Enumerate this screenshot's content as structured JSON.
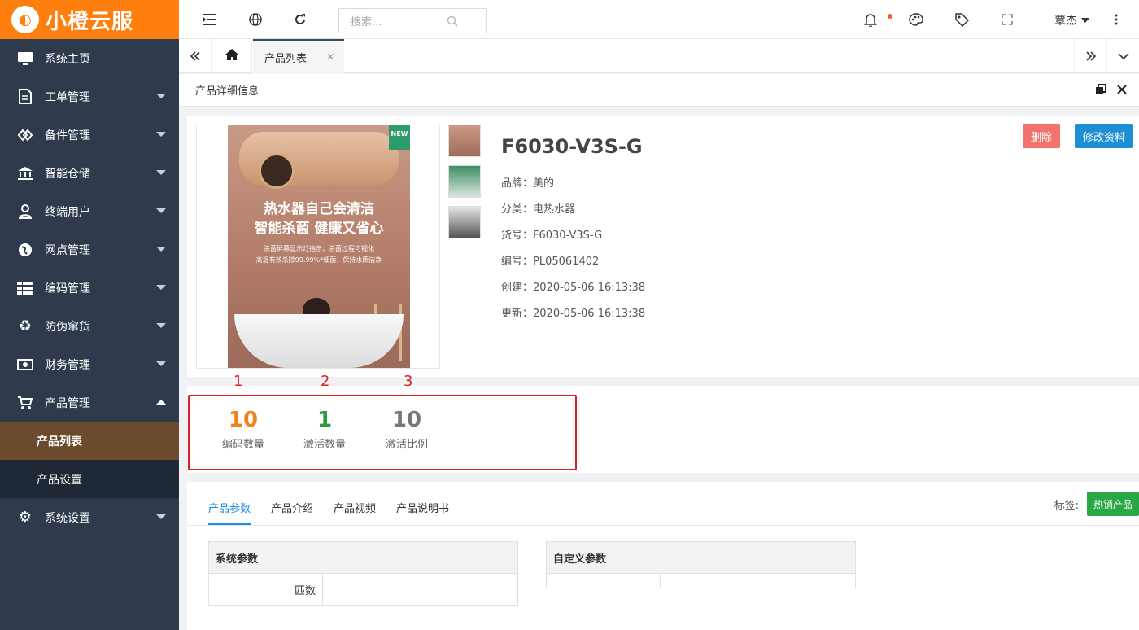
{
  "app": {
    "logo_text": "小橙云服"
  },
  "sidebar": {
    "items": [
      {
        "label": "系统主页",
        "icon": "monitor-icon"
      },
      {
        "label": "工单管理",
        "icon": "document-icon"
      },
      {
        "label": "备件管理",
        "icon": "parts-icon"
      },
      {
        "label": "智能仓储",
        "icon": "bank-icon"
      },
      {
        "label": "终端用户",
        "icon": "user-icon"
      },
      {
        "label": "网点管理",
        "icon": "globe-icon"
      },
      {
        "label": "编码管理",
        "icon": "grid-icon"
      },
      {
        "label": "防伪窜货",
        "icon": "recycle-icon"
      },
      {
        "label": "财务管理",
        "icon": "money-icon"
      },
      {
        "label": "产品管理",
        "icon": "cart-icon"
      },
      {
        "label": "系统设置",
        "icon": "gear-icon"
      }
    ],
    "product_sub": [
      "产品列表",
      "产品设置"
    ]
  },
  "header": {
    "search_placeholder": "搜索...",
    "user": "覃杰"
  },
  "tabs": {
    "current": "产品列表"
  },
  "panel": {
    "title": "产品详细信息"
  },
  "product": {
    "name": "F6030-V3S-G",
    "fields": [
      {
        "label": "品牌：",
        "value": "美的"
      },
      {
        "label": "分类：",
        "value": "电热水器"
      },
      {
        "label": "货号：",
        "value": "F6030-V3S-G"
      },
      {
        "label": "编号：",
        "value": "PL05061402"
      },
      {
        "label": "创建：",
        "value": "2020-05-06 16:13:38"
      },
      {
        "label": "更新：",
        "value": "2020-05-06 16:13:38"
      }
    ],
    "delete_label": "删除",
    "edit_label": "修改资料",
    "poster": {
      "badge": "NEW",
      "headline1": "热水器自己会清洁",
      "headline2": "智能杀菌 健康又省心",
      "sub1": "杀菌屏幕显示灯指示，杀菌过程可视化",
      "sub2": "高温有效杀除99.99%*细菌，保持水质洁净"
    }
  },
  "stats": {
    "markers": [
      "1",
      "2",
      "3"
    ],
    "items": [
      {
        "value": "10",
        "label": "编码数量",
        "color": "#f0821e"
      },
      {
        "value": "1",
        "label": "激活数量",
        "color": "#2a9d3a"
      },
      {
        "value": "10",
        "label": "激活比例",
        "color": "#777777"
      }
    ]
  },
  "detail_tabs": [
    "产品参数",
    "产品介绍",
    "产品视频",
    "产品说明书"
  ],
  "tag": {
    "label": "标签:",
    "value": "热销产品"
  },
  "tables": {
    "system": {
      "header": "系统参数",
      "row_label": "匹数"
    },
    "custom": {
      "header": "自定义参数"
    }
  }
}
